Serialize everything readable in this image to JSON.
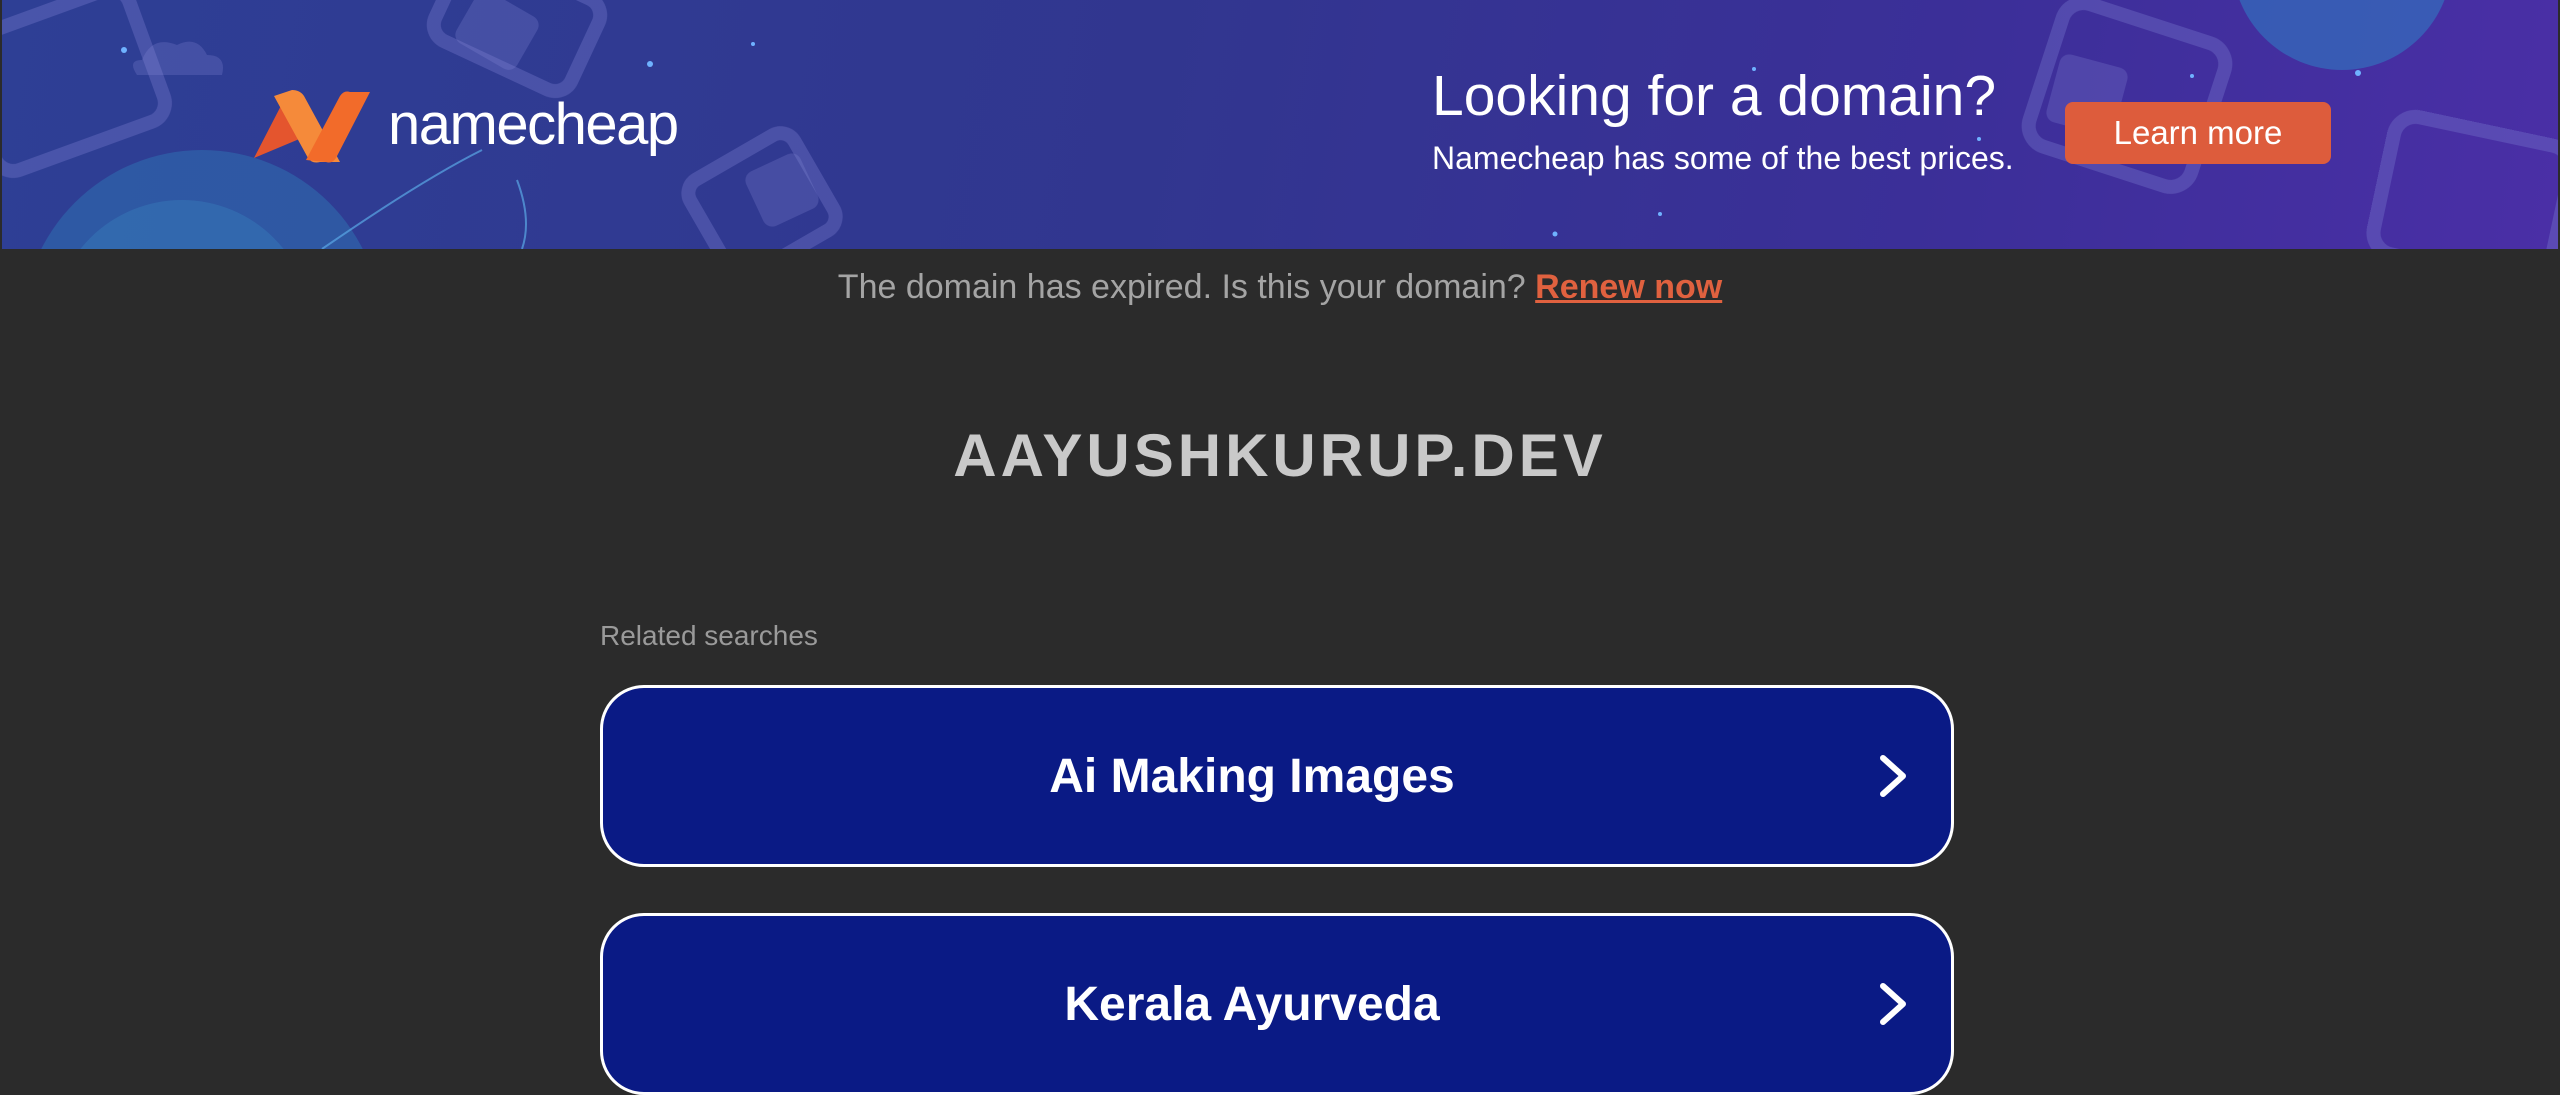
{
  "banner": {
    "logo_text": "namecheap",
    "headline": "Looking for a domain?",
    "subline": "Namecheap has some of the best prices.",
    "cta_label": "Learn more",
    "colors": {
      "accent": "#dd5c3c",
      "logo_orange": "#f26b2a"
    }
  },
  "notice": {
    "text": "The domain has expired. Is this your domain?",
    "link_label": "Renew now",
    "link_color": "#e0613f"
  },
  "domain": {
    "title": "AAYUSHKURUP.DEV"
  },
  "related": {
    "label": "Related searches",
    "items": [
      {
        "label": "Ai Making Images",
        "icon": "chevron-right-icon"
      },
      {
        "label": "Kerala Ayurveda",
        "icon": "chevron-right-icon"
      }
    ],
    "item_color": "#0a1a85"
  }
}
